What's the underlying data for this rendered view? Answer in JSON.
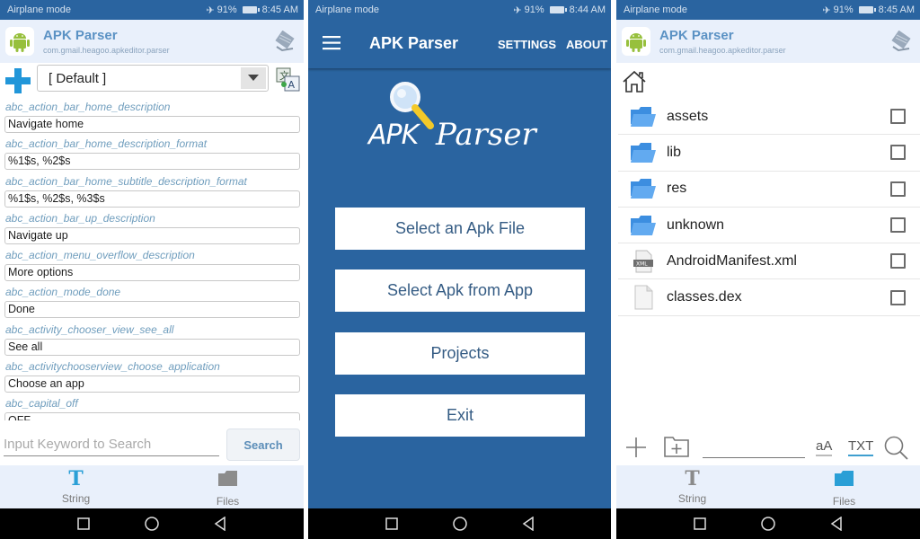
{
  "status_bars": [
    {
      "left": "Airplane mode",
      "battery": "91%",
      "time": "8:45 AM"
    },
    {
      "left": "Airplane mode",
      "battery": "91%",
      "time": "8:44 AM"
    },
    {
      "left": "Airplane mode",
      "battery": "91%",
      "time": "8:45 AM"
    }
  ],
  "app": {
    "title": "APK Parser",
    "package": "com.gmail.heagoo.apkeditor.parser",
    "icon_caption": "APK Parser"
  },
  "strings_screen": {
    "language_select": "[ Default ]",
    "entries": [
      {
        "key": "abc_action_bar_home_description",
        "value": "Navigate home"
      },
      {
        "key": "abc_action_bar_home_description_format",
        "value": "%1$s, %2$s"
      },
      {
        "key": "abc_action_bar_home_subtitle_description_format",
        "value": "%1$s, %2$s, %3$s"
      },
      {
        "key": "abc_action_bar_up_description",
        "value": "Navigate up"
      },
      {
        "key": "abc_action_menu_overflow_description",
        "value": "More options"
      },
      {
        "key": "abc_action_mode_done",
        "value": "Done"
      },
      {
        "key": "abc_activity_chooser_view_see_all",
        "value": "See all"
      },
      {
        "key": "abc_activitychooserview_choose_application",
        "value": "Choose an app"
      },
      {
        "key": "abc_capital_off",
        "value": "OFF"
      }
    ],
    "search_placeholder": "Input Keyword to Search",
    "search_button": "Search"
  },
  "bottom_tabs": [
    {
      "label": "String",
      "icon": "text-t-icon"
    },
    {
      "label": "Files",
      "icon": "folder-icon"
    }
  ],
  "main_screen": {
    "title": "APK Parser",
    "actions": [
      "SETTINGS",
      "ABOUT"
    ],
    "logo_text": {
      "left": "APK",
      "right": "Parser"
    },
    "buttons": [
      "Select an Apk File",
      "Select Apk from App",
      "Projects",
      "Exit"
    ]
  },
  "files_screen": {
    "files": [
      {
        "name": "assets",
        "type": "folder",
        "checked": false
      },
      {
        "name": "lib",
        "type": "folder",
        "checked": false
      },
      {
        "name": "res",
        "type": "folder",
        "checked": false
      },
      {
        "name": "unknown",
        "type": "folder",
        "checked": false
      },
      {
        "name": "AndroidManifest.xml",
        "type": "xml",
        "checked": false
      },
      {
        "name": "classes.dex",
        "type": "file",
        "checked": false
      }
    ],
    "path_input_value": "",
    "case_toggle": "aA",
    "txt_toggle": "TXT"
  },
  "colors": {
    "primary": "#2a64a0",
    "header_bg": "#e9f0fb",
    "accent": "#2196d9",
    "key_text": "#6f9dbd"
  }
}
